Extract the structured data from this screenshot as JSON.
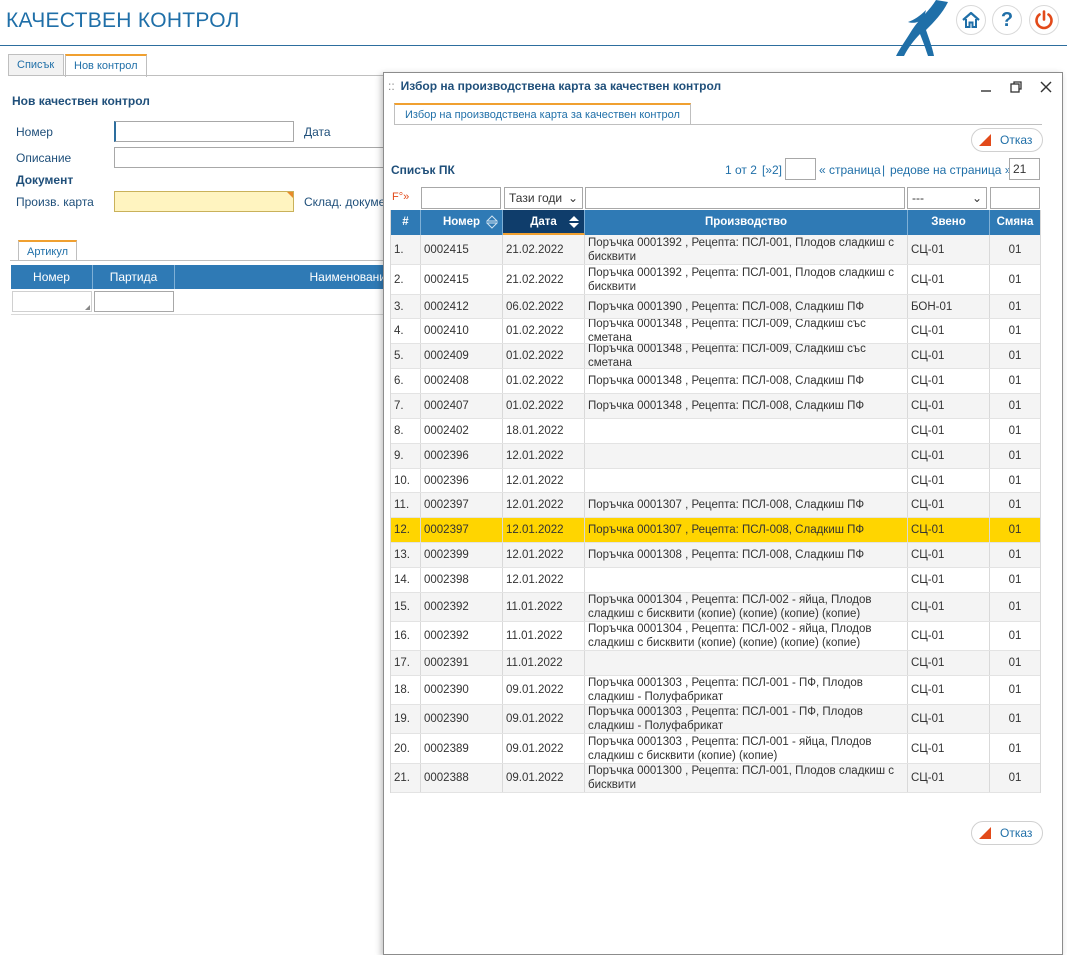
{
  "app": {
    "title": "КАЧЕСТВЕН КОНТРОЛ",
    "help_glyph": "?",
    "icons": [
      "brand-logo-icon",
      "home-icon",
      "help-icon",
      "power-icon"
    ],
    "accent_color": "#2f7ab5",
    "highlight_color": "#ffd500"
  },
  "main_tabs": [
    {
      "label": "Списък",
      "active": false
    },
    {
      "label": "Нов контрол",
      "active": true
    }
  ],
  "form": {
    "title": "Нов качествен контрол",
    "number_label": "Номер",
    "number_value": "",
    "date_label": "Дата",
    "description_label": "Описание",
    "document_label": "Документ",
    "production_card_label": "Произв. карта",
    "warehouse_doc_label": "Склад. докумен"
  },
  "article": {
    "tab_label": "Артикул",
    "columns": [
      "Номер",
      "Партида",
      "Наименовани"
    ]
  },
  "modal": {
    "title": "Избор на производствена карта за качествен контрол",
    "tab_label": "Избор на производствена карта за качествен контрол",
    "cancel_label": "Отказ",
    "list_title": "Списък ПК",
    "pager": {
      "page_text": "1 от 2",
      "next_text": "[»2]",
      "page_input": "",
      "page_label": "« страница",
      "separator": "|",
      "rows_label": "редове на страница »",
      "rows_per_page": "21"
    },
    "filters": {
      "marker": "F°»",
      "number": "",
      "period": "Тази годи",
      "production": "",
      "unit": "---",
      "shift": ""
    },
    "columns": [
      "#",
      "Номер",
      "Дата",
      "Производство",
      "Звено",
      "Смяна"
    ],
    "rows": [
      {
        "n": "1.",
        "number": "0002415",
        "date": "21.02.2022",
        "production": "Поръчка 0001392 , Рецепта: ПСЛ-001, Плодов сладкиш с бисквити",
        "unit": "СЦ-01",
        "shift": "01"
      },
      {
        "n": "2.",
        "number": "0002415",
        "date": "21.02.2022",
        "production": "Поръчка 0001392 , Рецепта: ПСЛ-001, Плодов сладкиш с бисквити",
        "unit": "СЦ-01",
        "shift": "01"
      },
      {
        "n": "3.",
        "number": "0002412",
        "date": "06.02.2022",
        "production": "Поръчка 0001390 , Рецепта: ПСЛ-008, Сладкиш ПФ",
        "unit": "БОН-01",
        "shift": "01"
      },
      {
        "n": "4.",
        "number": "0002410",
        "date": "01.02.2022",
        "production": "Поръчка 0001348 , Рецепта: ПСЛ-009, Сладкиш със сметана",
        "unit": "СЦ-01",
        "shift": "01"
      },
      {
        "n": "5.",
        "number": "0002409",
        "date": "01.02.2022",
        "production": "Поръчка 0001348 , Рецепта: ПСЛ-009, Сладкиш със сметана",
        "unit": "СЦ-01",
        "shift": "01"
      },
      {
        "n": "6.",
        "number": "0002408",
        "date": "01.02.2022",
        "production": "Поръчка 0001348 , Рецепта: ПСЛ-008, Сладкиш ПФ",
        "unit": "СЦ-01",
        "shift": "01"
      },
      {
        "n": "7.",
        "number": "0002407",
        "date": "01.02.2022",
        "production": "Поръчка 0001348 , Рецепта: ПСЛ-008, Сладкиш ПФ",
        "unit": "СЦ-01",
        "shift": "01"
      },
      {
        "n": "8.",
        "number": "0002402",
        "date": "18.01.2022",
        "production": "",
        "unit": "СЦ-01",
        "shift": "01"
      },
      {
        "n": "9.",
        "number": "0002396",
        "date": "12.01.2022",
        "production": "",
        "unit": "СЦ-01",
        "shift": "01"
      },
      {
        "n": "10.",
        "number": "0002396",
        "date": "12.01.2022",
        "production": "",
        "unit": "СЦ-01",
        "shift": "01"
      },
      {
        "n": "11.",
        "number": "0002397",
        "date": "12.01.2022",
        "production": "Поръчка 0001307 , Рецепта: ПСЛ-008, Сладкиш ПФ",
        "unit": "СЦ-01",
        "shift": "01"
      },
      {
        "n": "12.",
        "number": "0002397",
        "date": "12.01.2022",
        "production": "Поръчка 0001307 , Рецепта: ПСЛ-008, Сладкиш ПФ",
        "unit": "СЦ-01",
        "shift": "01",
        "selected": true
      },
      {
        "n": "13.",
        "number": "0002399",
        "date": "12.01.2022",
        "production": "Поръчка 0001308 , Рецепта: ПСЛ-008, Сладкиш ПФ",
        "unit": "СЦ-01",
        "shift": "01"
      },
      {
        "n": "14.",
        "number": "0002398",
        "date": "12.01.2022",
        "production": "",
        "unit": "СЦ-01",
        "shift": "01"
      },
      {
        "n": "15.",
        "number": "0002392",
        "date": "11.01.2022",
        "production": "Поръчка 0001304 , Рецепта: ПСЛ-002 - яйца, Плодов сладкиш с бисквити (копие) (копие) (копие) (копие)",
        "unit": "СЦ-01",
        "shift": "01"
      },
      {
        "n": "16.",
        "number": "0002392",
        "date": "11.01.2022",
        "production": "Поръчка 0001304 , Рецепта: ПСЛ-002 - яйца, Плодов сладкиш с бисквити (копие) (копие) (копие) (копие)",
        "unit": "СЦ-01",
        "shift": "01"
      },
      {
        "n": "17.",
        "number": "0002391",
        "date": "11.01.2022",
        "production": "",
        "unit": "СЦ-01",
        "shift": "01"
      },
      {
        "n": "18.",
        "number": "0002390",
        "date": "09.01.2022",
        "production": "Поръчка 0001303 , Рецепта: ПСЛ-001 - ПФ, Плодов сладкиш - Полуфабрикат",
        "unit": "СЦ-01",
        "shift": "01"
      },
      {
        "n": "19.",
        "number": "0002390",
        "date": "09.01.2022",
        "production": "Поръчка 0001303 , Рецепта: ПСЛ-001 - ПФ, Плодов сладкиш - Полуфабрикат",
        "unit": "СЦ-01",
        "shift": "01"
      },
      {
        "n": "20.",
        "number": "0002389",
        "date": "09.01.2022",
        "production": "Поръчка 0001303 , Рецепта: ПСЛ-001 - яйца, Плодов сладкиш с бисквити (копие) (копие)",
        "unit": "СЦ-01",
        "shift": "01"
      },
      {
        "n": "21.",
        "number": "0002388",
        "date": "09.01.2022",
        "production": "Поръчка 0001300 , Рецепта: ПСЛ-001, Плодов сладкиш с бисквити",
        "unit": "СЦ-01",
        "shift": "01"
      }
    ]
  }
}
